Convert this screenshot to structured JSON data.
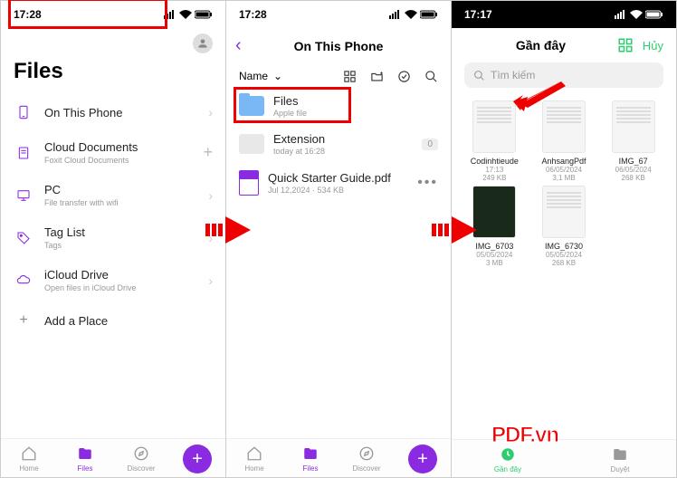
{
  "status": {
    "time1": "17:28",
    "time2": "17:28",
    "time3": "17:17"
  },
  "screen1": {
    "title": "Files",
    "rows": [
      {
        "label": "On This Phone",
        "sub": ""
      },
      {
        "label": "Cloud Documents",
        "sub": "Foxit Cloud Documents"
      },
      {
        "label": "PC",
        "sub": "File transfer with wifi"
      },
      {
        "label": "Tag List",
        "sub": "Tags"
      },
      {
        "label": "iCloud Drive",
        "sub": "Open files in iCloud Drive"
      },
      {
        "label": "Add a Place",
        "sub": ""
      }
    ]
  },
  "screen2": {
    "title": "On This Phone",
    "sort_label": "Name",
    "items": [
      {
        "label": "Files",
        "sub": "Apple file",
        "type": "folder"
      },
      {
        "label": "Extension",
        "sub": "today at 16:28",
        "type": "ext",
        "badge": "0"
      },
      {
        "label": "Quick Starter Guide.pdf",
        "sub": "Jul 12,2024 · 534 KB",
        "type": "file"
      }
    ]
  },
  "screen3": {
    "title": "Gần đây",
    "cancel_label": "Hủy",
    "search_placeholder": "Tìm kiếm",
    "files": [
      {
        "name": "Codinhtieude",
        "date": "17:13",
        "size": "249 KB"
      },
      {
        "name": "AnhsangPdf",
        "date": "06/05/2024",
        "size": "3,1 MB"
      },
      {
        "name": "IMG_67",
        "date": "06/05/2024",
        "size": "268 KB"
      },
      {
        "name": "IMG_6703",
        "date": "05/05/2024",
        "size": "3 MB"
      },
      {
        "name": "IMG_6730",
        "date": "05/05/2024",
        "size": "268 KB"
      }
    ]
  },
  "nav": {
    "home": "Home",
    "files": "Files",
    "discover": "Discover",
    "recent": "Gần đây",
    "browse": "Duyệt"
  },
  "watermark": "PDF.vn"
}
